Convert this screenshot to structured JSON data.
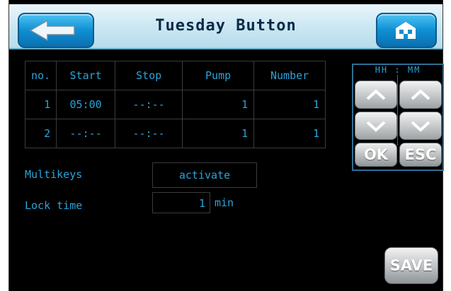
{
  "header": {
    "title": "Tuesday Button",
    "back_icon": "arrow-left-icon",
    "home_icon": "home-icon"
  },
  "schedule": {
    "columns": [
      "no.",
      "Start",
      "Stop",
      "Pump",
      "Number"
    ],
    "rows": [
      {
        "no": "1",
        "start": "05:00",
        "stop": "--:--",
        "pump": "1",
        "number": "1"
      },
      {
        "no": "2",
        "start": "--:--",
        "stop": "--:--",
        "pump": "1",
        "number": "1"
      }
    ]
  },
  "time_panel": {
    "hh_label": "HH",
    "separator": ":",
    "mm_label": "MM",
    "up_icon": "chevron-up-icon",
    "down_icon": "chevron-down-icon",
    "ok_label": "OK",
    "esc_label": "ESC"
  },
  "settings": {
    "multikeys_label": "Multikeys",
    "multikeys_value": "activate",
    "lock_time_label": "Lock time",
    "lock_time_value": "1",
    "lock_time_unit": "min"
  },
  "footer": {
    "save_label": "SAVE"
  },
  "colors": {
    "text": "#2ba3d9",
    "active_text": "#ffffff",
    "header_button": "#0e8fd3",
    "background": "#000000"
  }
}
